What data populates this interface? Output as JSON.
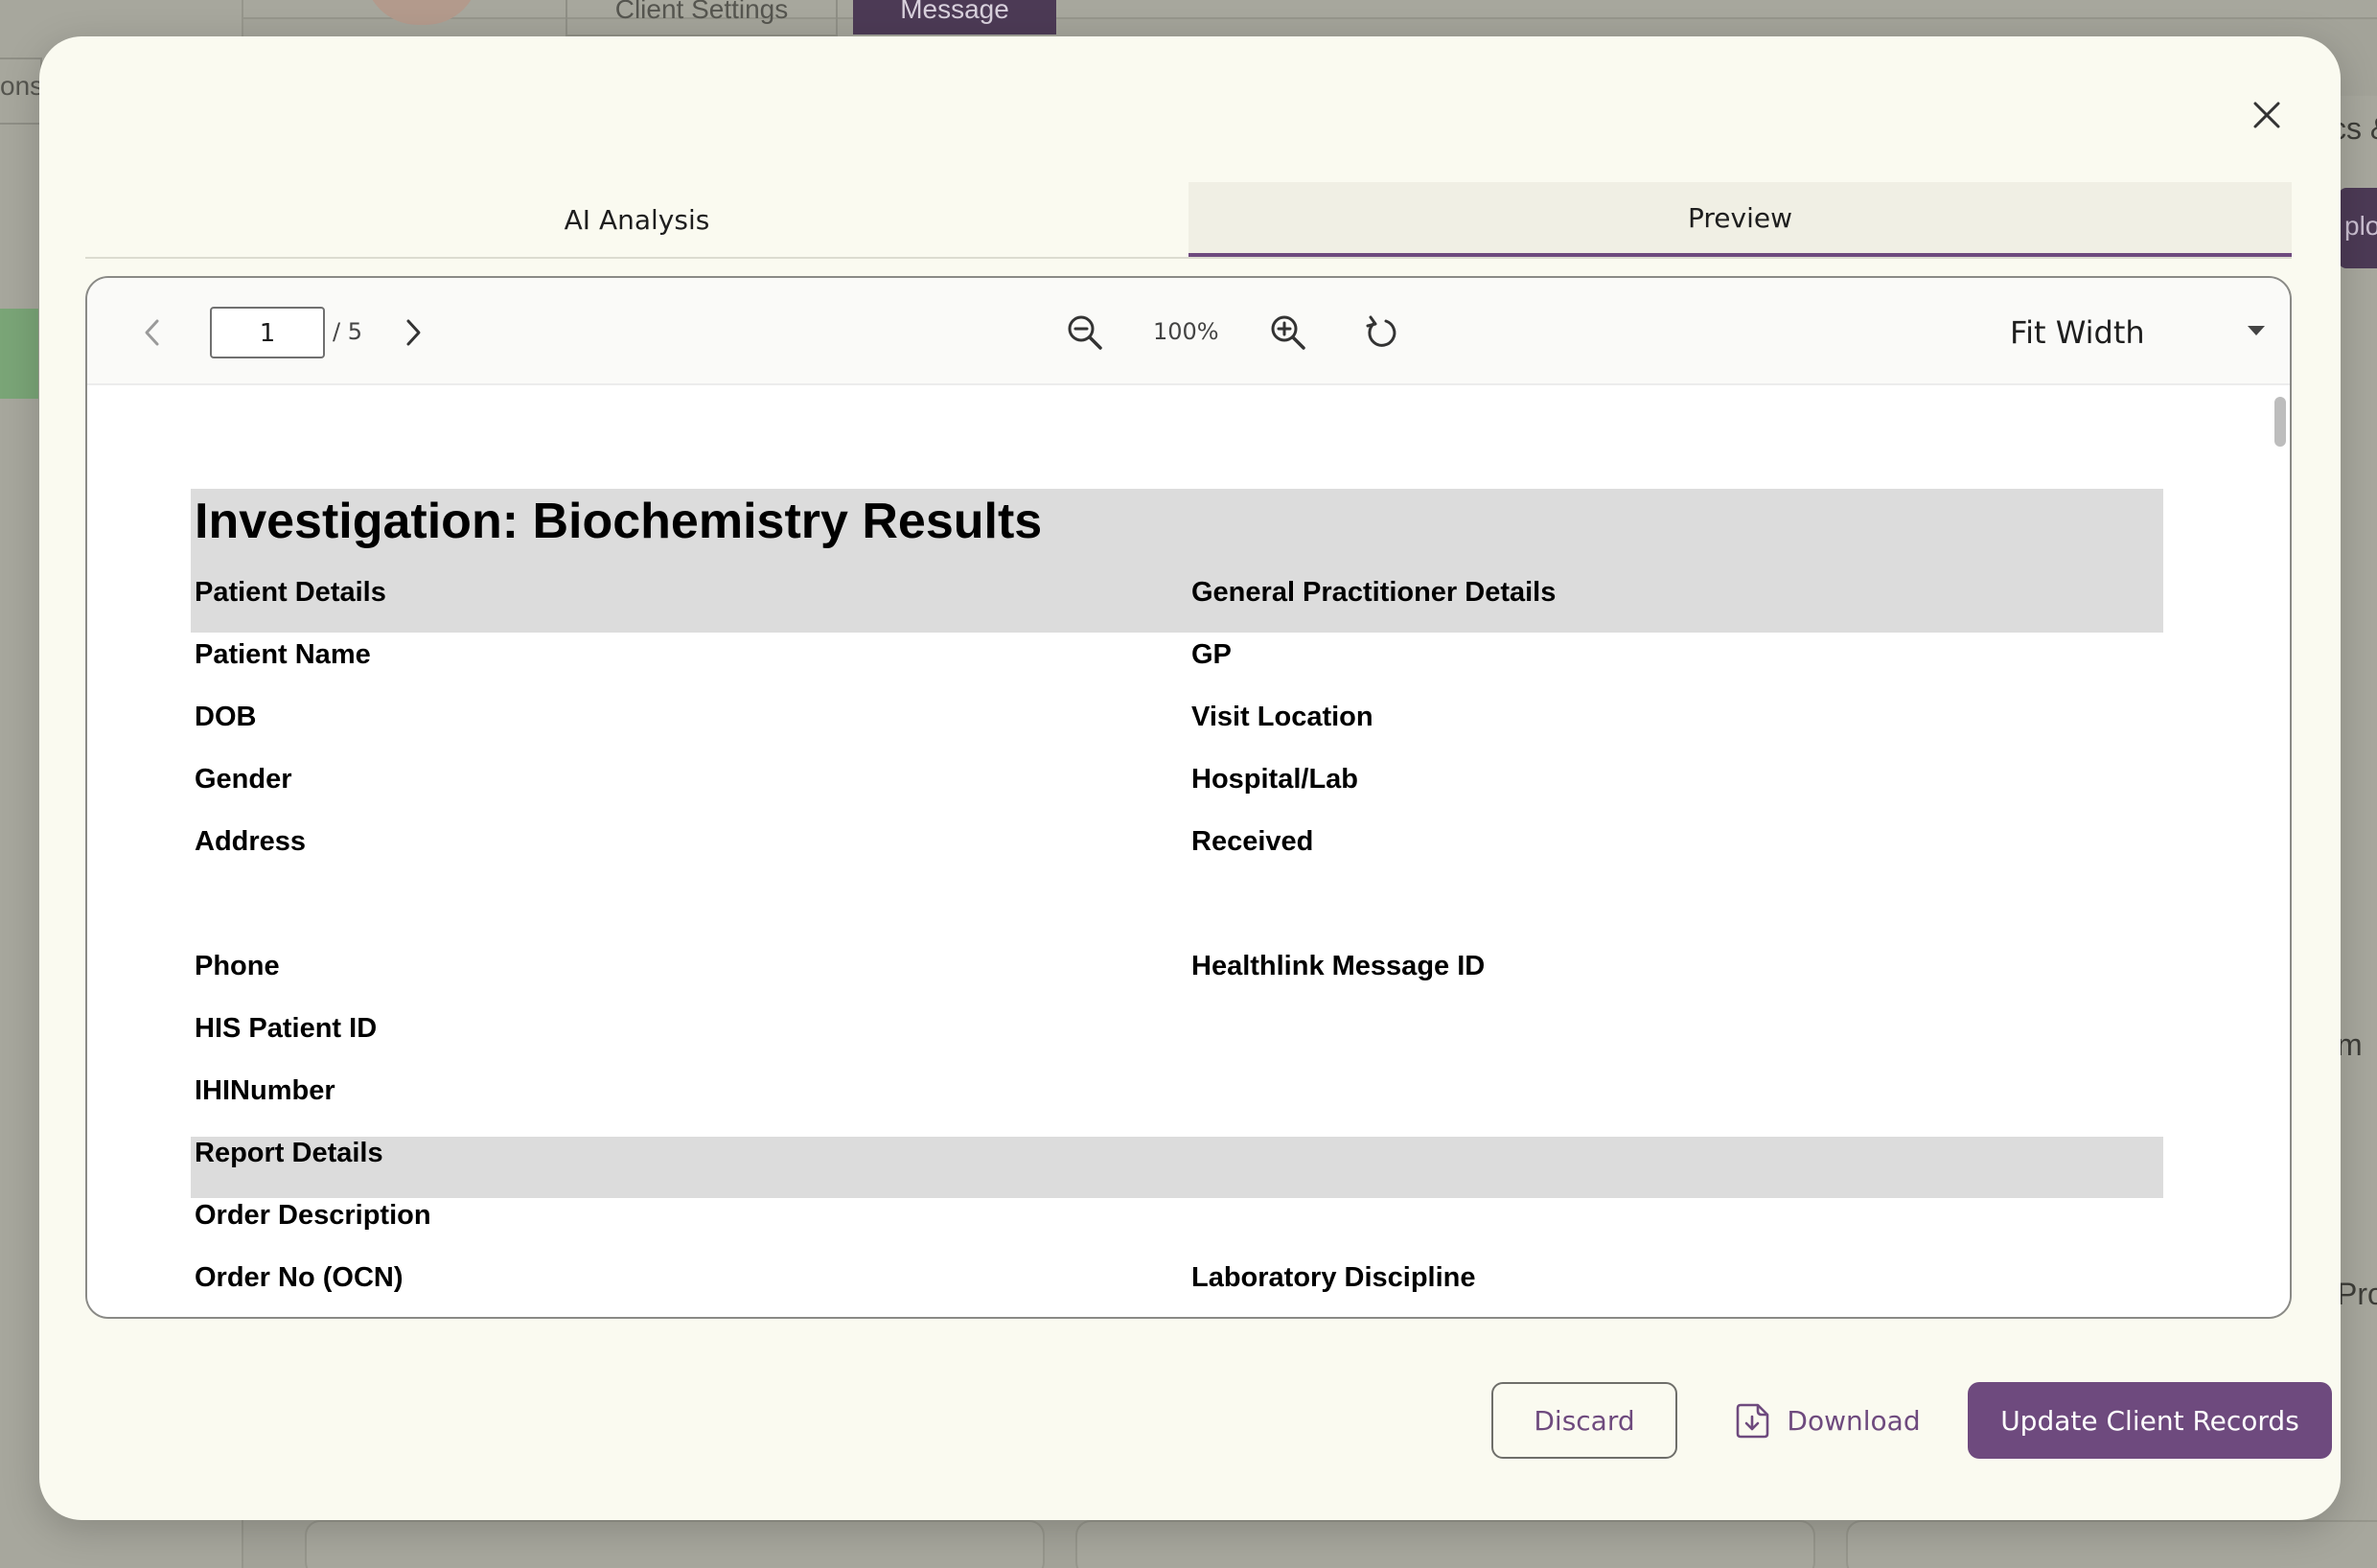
{
  "background": {
    "sidebar_tab_label": "ons",
    "tab_client_settings": "Client Settings",
    "tab_message": "Message",
    "right_tab_label": "cs &",
    "right_button_label": "plo",
    "right_text_1": "m",
    "right_text_2": "Pro"
  },
  "modal": {
    "tabs": [
      {
        "label": "AI Analysis",
        "active": false
      },
      {
        "label": "Preview",
        "active": true
      }
    ],
    "viewer": {
      "current_page": "1",
      "page_total": "/ 5",
      "zoom_level": "100%",
      "fit_mode": "Fit Width"
    },
    "document": {
      "title": "Investigation: Biochemistry Results",
      "patient_details_heading": "Patient Details",
      "gp_details_heading": "General Practitioner Details",
      "left_fields": [
        "Patient Name",
        "DOB",
        "Gender",
        "Address",
        "Phone",
        "HIS Patient ID",
        "IHINumber"
      ],
      "right_fields": [
        "GP",
        "Visit Location",
        "Hospital/Lab",
        "Received",
        "Healthlink Message ID"
      ],
      "report_details_heading": "Report Details",
      "order_description": "Order Description",
      "order_no": "Order No (OCN)",
      "laboratory_discipline": "Laboratory Discipline"
    },
    "footer": {
      "discard_label": "Discard",
      "download_label": "Download",
      "update_label": "Update Client Records"
    }
  },
  "colors": {
    "accent": "#6e4a7e",
    "modal_background": "#fafaf0",
    "band_gray": "#dcdcdc"
  }
}
